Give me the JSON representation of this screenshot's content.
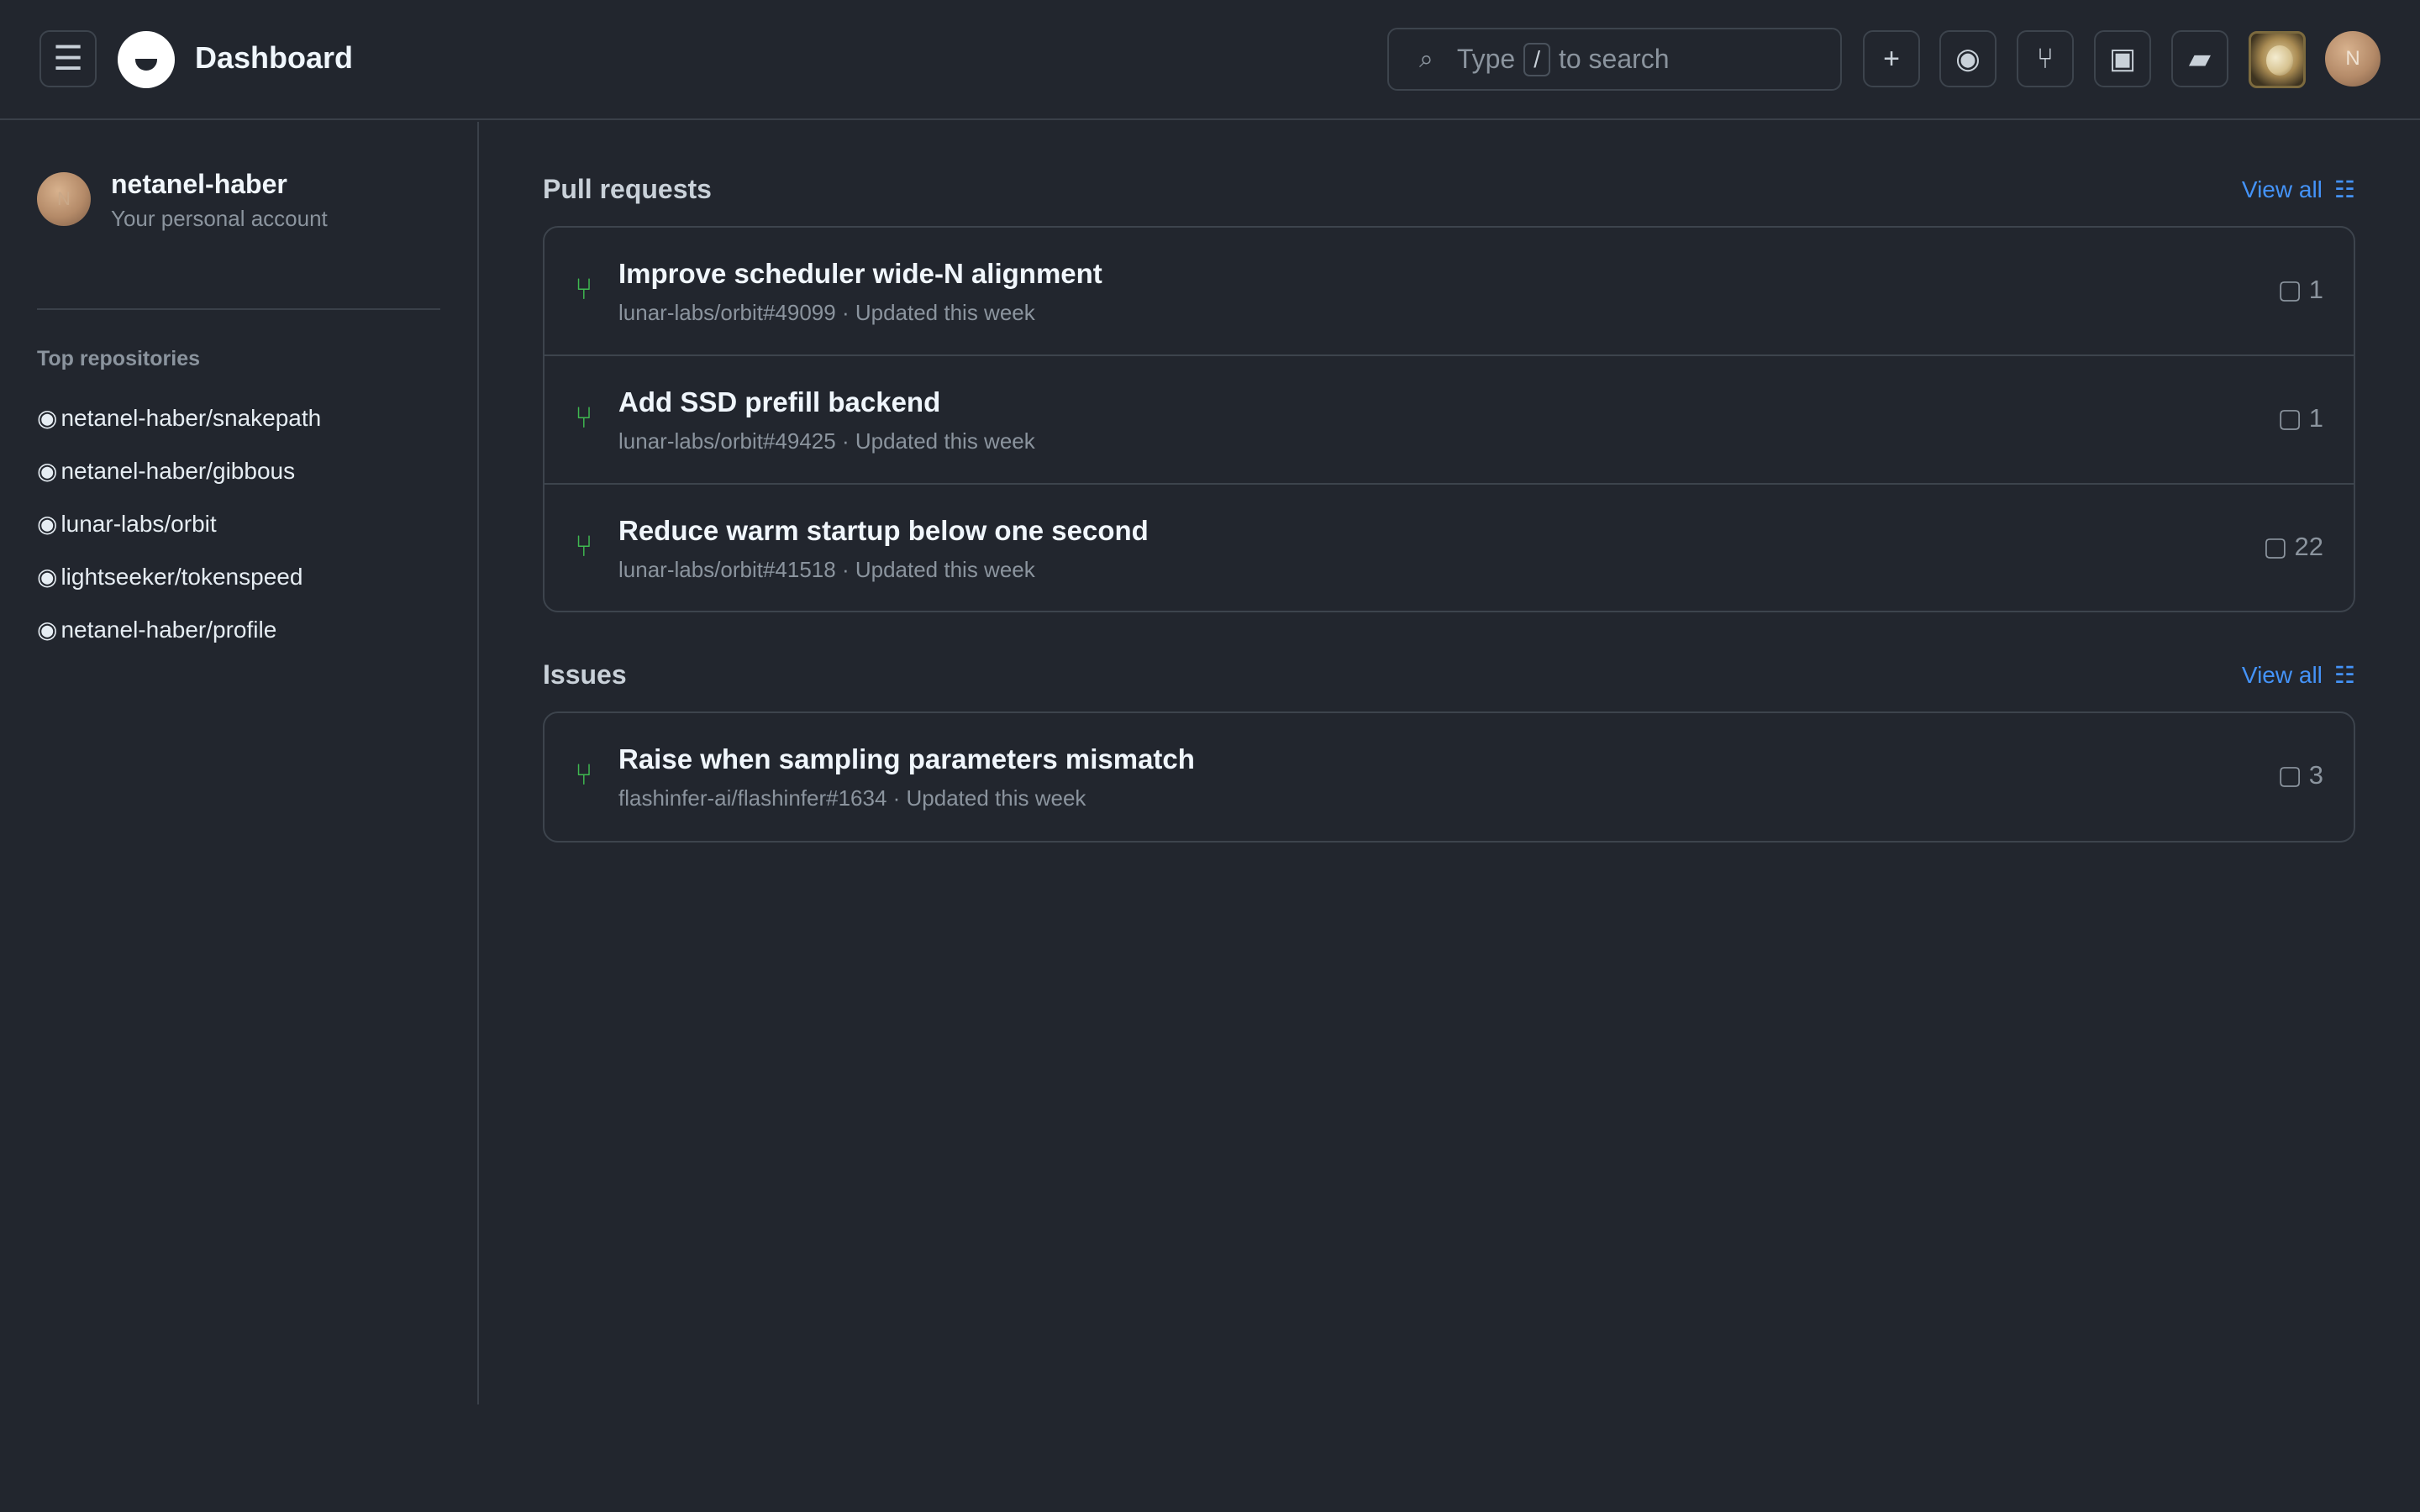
{
  "header": {
    "menu_icon": "☰",
    "title": "Dashboard",
    "search": {
      "prefix": "Type",
      "key": "/",
      "suffix": "to search",
      "icon": "⌕"
    },
    "buttons": {
      "plus": "+",
      "issues": "◉",
      "pull_requests": "⑂",
      "inbox": "▣",
      "copilot": "▰"
    },
    "avatar_initial": "N"
  },
  "sidebar": {
    "avatar_initial": "N",
    "username": "netanel-haber",
    "account_label": "Your personal account",
    "top_repos_heading": "Top repositories",
    "repo_icon": "◉",
    "repos": [
      "netanel-haber/snakepath",
      "netanel-haber/gibbous",
      "lunar-labs/orbit",
      "lightseeker/tokenspeed",
      "netanel-haber/profile"
    ]
  },
  "pull_requests": {
    "heading": "Pull requests",
    "view_all": "View all",
    "view_all_icon": "☷",
    "items": [
      {
        "title": "Improve scheduler wide-N alignment",
        "meta": "lunar-labs/orbit#49099 · Updated this week",
        "comments": "1",
        "icon": "⑂",
        "comment_icon": "▢"
      },
      {
        "title": "Add SSD prefill backend",
        "meta": "lunar-labs/orbit#49425 · Updated this week",
        "comments": "1",
        "icon": "⑂",
        "comment_icon": "▢"
      },
      {
        "title": "Reduce warm startup below one second",
        "meta": "lunar-labs/orbit#41518 · Updated this week",
        "comments": "22",
        "icon": "⑂",
        "comment_icon": "▢"
      }
    ]
  },
  "issues": {
    "heading": "Issues",
    "view_all": "View all",
    "view_all_icon": "☷",
    "items": [
      {
        "title": "Raise when sampling parameters mismatch",
        "meta": "flashinfer-ai/flashinfer#1634 · Updated this week",
        "comments": "3",
        "icon": "⑂",
        "comment_icon": "▢"
      }
    ]
  },
  "colors": {
    "background": "#22262e",
    "border": "#3d444d",
    "accent_link": "#4493f8",
    "pr_open": "#3fb950",
    "muted_text": "#8b949e"
  }
}
